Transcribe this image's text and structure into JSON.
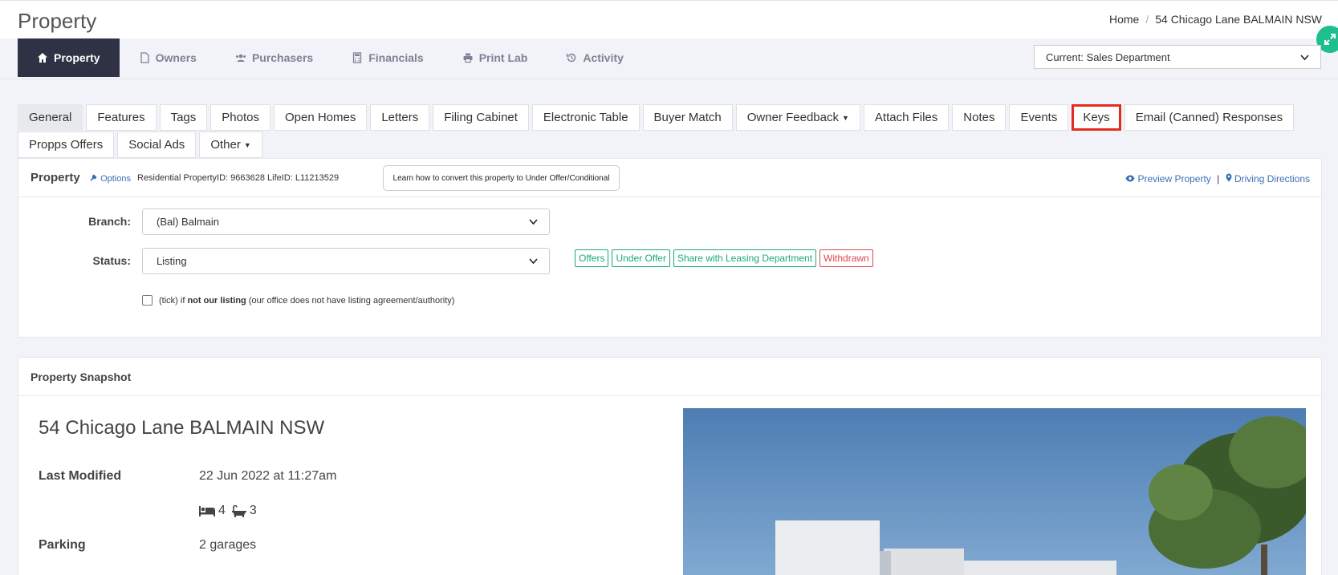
{
  "header": {
    "title": "Property",
    "breadcrumb": {
      "home": "Home",
      "separator": "/",
      "current": "54 Chicago Lane BALMAIN NSW"
    }
  },
  "main_nav": {
    "items": [
      {
        "label": "Property",
        "icon": "home-icon",
        "active": true
      },
      {
        "label": "Owners",
        "icon": "document-icon"
      },
      {
        "label": "Purchasers",
        "icon": "users-icon"
      },
      {
        "label": "Financials",
        "icon": "calculator-icon"
      },
      {
        "label": "Print Lab",
        "icon": "printer-icon"
      },
      {
        "label": "Activity",
        "icon": "history-icon"
      }
    ],
    "department": "Current: Sales Department"
  },
  "tabs": [
    {
      "label": "General",
      "active": true
    },
    {
      "label": "Features"
    },
    {
      "label": "Tags"
    },
    {
      "label": "Photos"
    },
    {
      "label": "Open Homes"
    },
    {
      "label": "Letters"
    },
    {
      "label": "Filing Cabinet"
    },
    {
      "label": "Electronic Table"
    },
    {
      "label": "Buyer Match"
    },
    {
      "label": "Owner Feedback",
      "dropdown": true
    },
    {
      "label": "Attach Files"
    },
    {
      "label": "Notes"
    },
    {
      "label": "Events"
    },
    {
      "label": "Keys",
      "highlight": true
    },
    {
      "label": "Email (Canned) Responses"
    },
    {
      "label": "Propps Offers"
    },
    {
      "label": "Social Ads"
    },
    {
      "label": "Other",
      "dropdown": true
    }
  ],
  "property_panel": {
    "title": "Property",
    "options_label": "Options",
    "meta": "Residential PropertyID: 9663628 LifeID: L11213529",
    "learn_button": "Learn how to convert this property to Under Offer/Conditional",
    "preview_link": "Preview Property",
    "link_separator": "|",
    "directions_link": "Driving Directions",
    "branch_label": "Branch:",
    "branch_value": "(Bal) Balmain",
    "status_label": "Status:",
    "status_value": "Listing",
    "status_badges": [
      {
        "label": "Offers",
        "color": "green"
      },
      {
        "label": "Under Offer",
        "color": "green"
      },
      {
        "label": "Share with Leasing Department",
        "color": "green"
      },
      {
        "label": "Withdrawn",
        "color": "red"
      }
    ],
    "checkbox": {
      "pre": "(tick) if ",
      "bold": "not our listing",
      "post": " (our office does not have listing agreement/authority)"
    }
  },
  "snapshot": {
    "title": "Property Snapshot",
    "address": "54 Chicago Lane BALMAIN NSW",
    "last_modified_label": "Last Modified",
    "last_modified_value": "22 Jun 2022 at 11:27am",
    "bedrooms": "4",
    "bathrooms": "3",
    "parking_label": "Parking",
    "parking_value": "2 garages"
  },
  "colors": {
    "accent": "#2f3145",
    "green": "#1aa87c",
    "red": "#e0454f",
    "highlight": "#e52b1e",
    "link": "#3a6fb5"
  }
}
